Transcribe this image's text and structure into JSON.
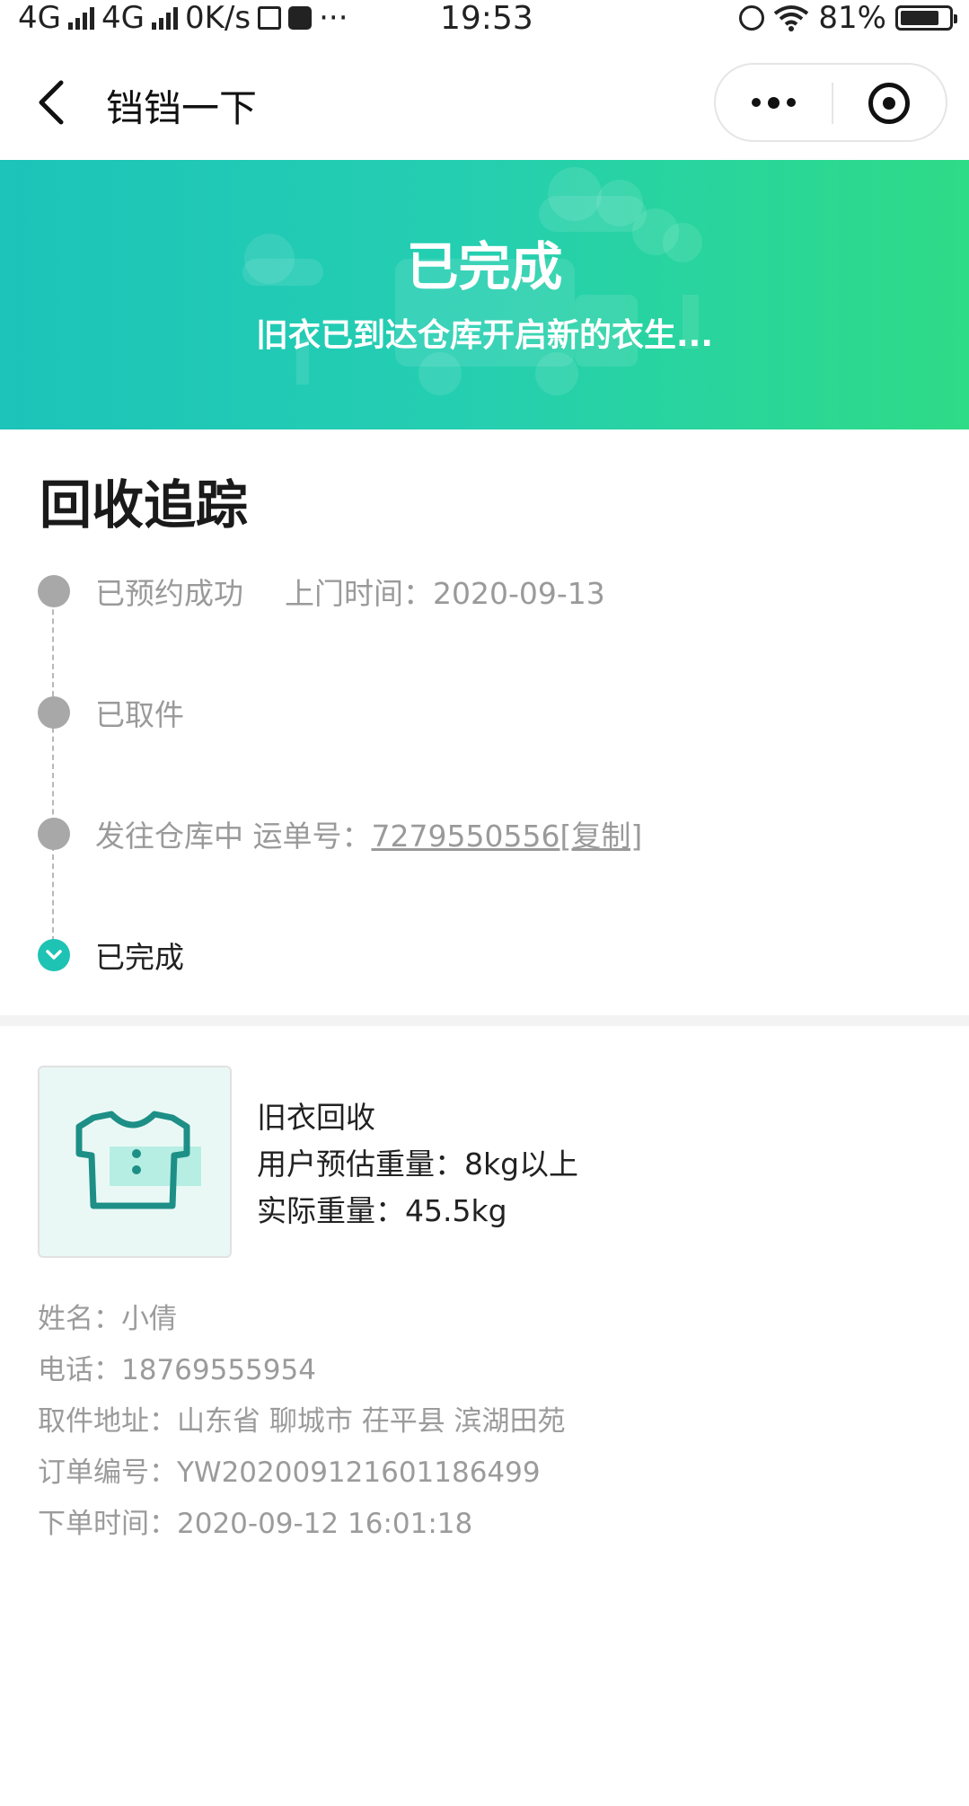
{
  "status_bar": {
    "network_left": "4G",
    "network_right": "4G",
    "speed": "0K/s",
    "time": "19:53",
    "battery": "81%",
    "battery_level": 0.81
  },
  "nav": {
    "title": "铛铛一下"
  },
  "banner": {
    "title": "已完成",
    "subtitle": "旧衣已到达仓库开启新的衣生..."
  },
  "tracking": {
    "title": "回收追踪",
    "steps": [
      {
        "label": "已预约成功",
        "extra": "上门时间：2020-09-13"
      },
      {
        "label": "已取件"
      },
      {
        "label": "发往仓库中 运单号：",
        "tracking_no": "7279550556",
        "copy": "[复制]"
      },
      {
        "label": "已完成"
      }
    ]
  },
  "product": {
    "name": "旧衣回收",
    "estimate": "用户预估重量：8kg以上",
    "actual": "实际重量：45.5kg",
    "icon": "tshirt-icon"
  },
  "details": {
    "name": "姓名：小倩",
    "phone": "电话：18769555954",
    "address": "取件地址：山东省 聊城市 茌平县 滨湖田苑",
    "order_no": "订单编号：YW202009121601186499",
    "order_time": "下单时间：2020-09-12 16:01:18"
  },
  "colors": {
    "accent": "#1ec3b4",
    "banner_start": "#1cc4b9",
    "banner_end": "#2edb86",
    "muted_text": "#9a9a9a"
  }
}
